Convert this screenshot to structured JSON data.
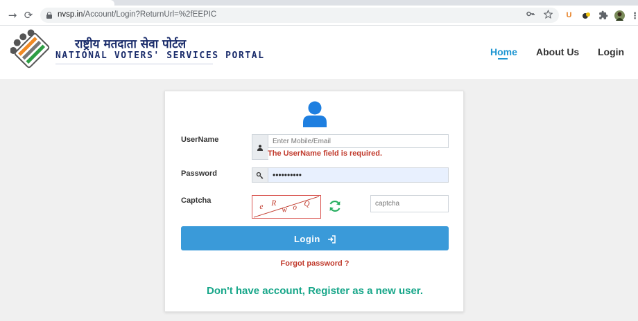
{
  "browser": {
    "url_host": "nvsp.in",
    "url_path": "/Account/Login?ReturnUrl=%2fEEPIC",
    "back_glyph": "→",
    "reload_glyph": "⟳",
    "icons": [
      "back-arrow-icon",
      "reload-icon",
      "lock-icon",
      "key-icon",
      "star-icon",
      "extension-u-icon",
      "extension-icon",
      "puzzle-icon",
      "profile-avatar-icon",
      "menu-icon"
    ]
  },
  "header": {
    "brand_hindi": "राष्ट्रीय मतदाता सेवा पोर्टल",
    "brand_english": "NATIONAL VOTERS' SERVICES PORTAL",
    "nav": {
      "home": "Home",
      "about": "About Us",
      "login": "Login"
    },
    "active_nav": "Home"
  },
  "form": {
    "username_label": "UserName",
    "username_placeholder": "Enter Mobile/Email",
    "username_value": "",
    "username_error": "The UserName field is required.",
    "password_label": "Password",
    "password_value": "••••••••••",
    "captcha_label": "Captcha",
    "captcha_chars": [
      "e",
      "R",
      "w",
      "o",
      "Q"
    ],
    "captcha_placeholder": "captcha",
    "login_button": "Login",
    "forgot_password": "Forgot password ?",
    "register_text": "Don't have account, Register as a new user."
  },
  "colors": {
    "accent": "#1e96d2",
    "button": "#3a9ad9",
    "error": "#c0392b",
    "register": "#17a689",
    "user_icon": "#1e7fe0",
    "refresh_icon": "#27ae60"
  }
}
